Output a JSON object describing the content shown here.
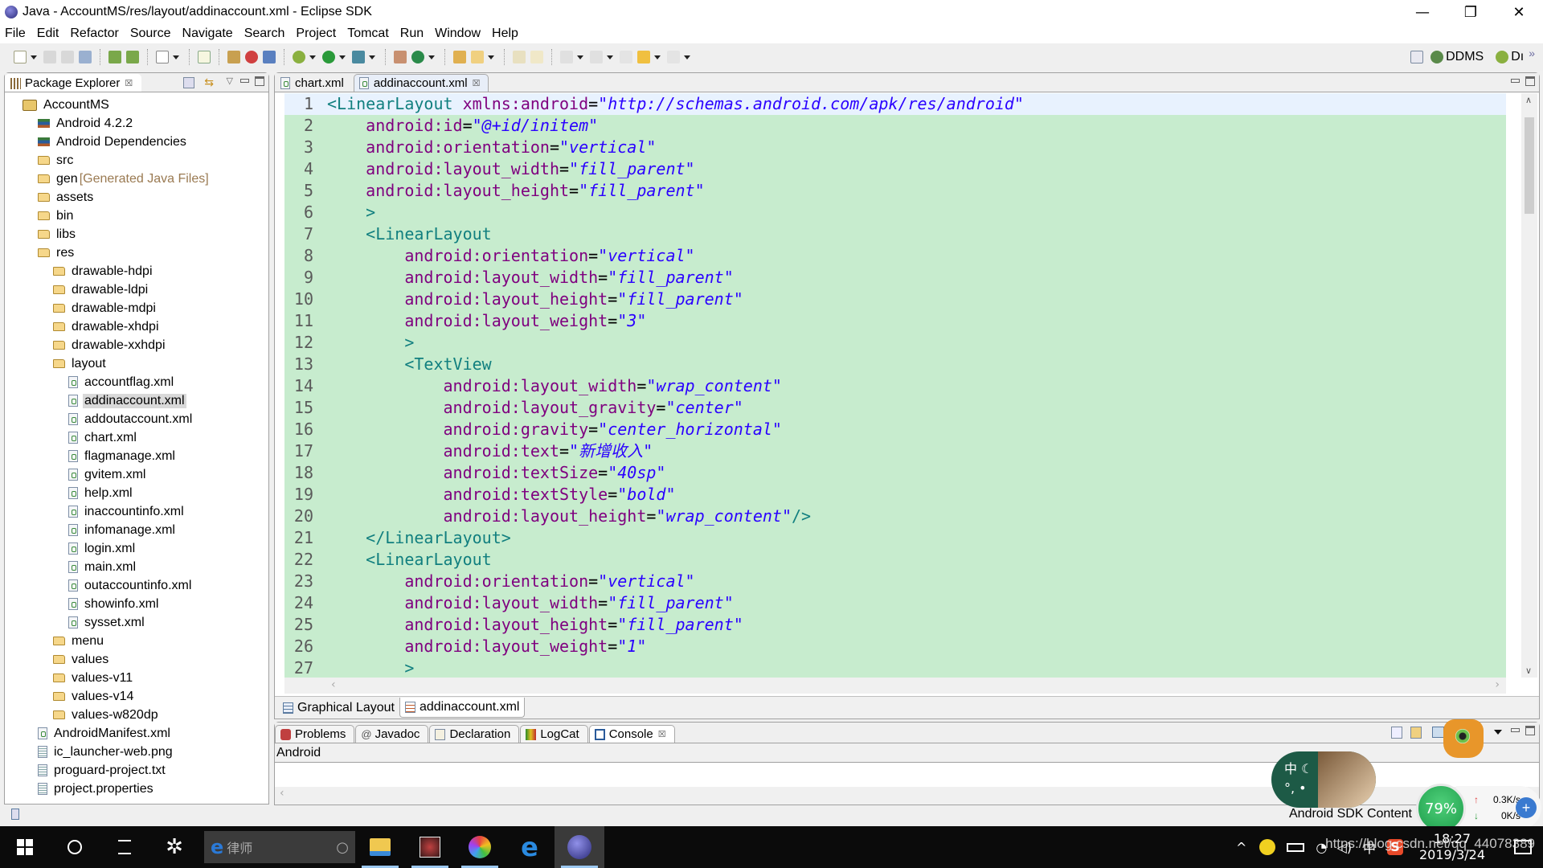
{
  "window": {
    "title": "Java - AccountMS/res/layout/addinaccount.xml - Eclipse SDK",
    "minimize": "—",
    "restore": "❐",
    "close": "✕"
  },
  "menu": [
    "File",
    "Edit",
    "Refactor",
    "Source",
    "Navigate",
    "Search",
    "Project",
    "Tomcat",
    "Run",
    "Window",
    "Help"
  ],
  "perspectives": {
    "ddms": "DDMS",
    "debug": "Dı",
    "more": "»"
  },
  "package_explorer": {
    "title": "Package Explorer",
    "close": "☒",
    "items": [
      {
        "label": "AccountMS",
        "type": "project",
        "depth": 0
      },
      {
        "label": "Android 4.2.2",
        "type": "library",
        "depth": 1
      },
      {
        "label": "Android Dependencies",
        "type": "library",
        "depth": 1
      },
      {
        "label": "src",
        "type": "folder",
        "depth": 1
      },
      {
        "label": "gen",
        "type": "folder",
        "depth": 1,
        "decoration": "[Generated Java Files]"
      },
      {
        "label": "assets",
        "type": "folder",
        "depth": 1
      },
      {
        "label": "bin",
        "type": "folder",
        "depth": 1
      },
      {
        "label": "libs",
        "type": "folder",
        "depth": 1
      },
      {
        "label": "res",
        "type": "folder",
        "depth": 1
      },
      {
        "label": "drawable-hdpi",
        "type": "folder",
        "depth": 2
      },
      {
        "label": "drawable-ldpi",
        "type": "folder",
        "depth": 2
      },
      {
        "label": "drawable-mdpi",
        "type": "folder",
        "depth": 2
      },
      {
        "label": "drawable-xhdpi",
        "type": "folder",
        "depth": 2
      },
      {
        "label": "drawable-xxhdpi",
        "type": "folder",
        "depth": 2
      },
      {
        "label": "layout",
        "type": "folder",
        "depth": 2
      },
      {
        "label": "accountflag.xml",
        "type": "xml",
        "depth": 3
      },
      {
        "label": "addinaccount.xml",
        "type": "xml",
        "depth": 3,
        "selected": true
      },
      {
        "label": "addoutaccount.xml",
        "type": "xml",
        "depth": 3
      },
      {
        "label": "chart.xml",
        "type": "xml",
        "depth": 3
      },
      {
        "label": "flagmanage.xml",
        "type": "xml",
        "depth": 3
      },
      {
        "label": "gvitem.xml",
        "type": "xml",
        "depth": 3
      },
      {
        "label": "help.xml",
        "type": "xml",
        "depth": 3
      },
      {
        "label": "inaccountinfo.xml",
        "type": "xml",
        "depth": 3
      },
      {
        "label": "infomanage.xml",
        "type": "xml",
        "depth": 3
      },
      {
        "label": "login.xml",
        "type": "xml",
        "depth": 3
      },
      {
        "label": "main.xml",
        "type": "xml",
        "depth": 3
      },
      {
        "label": "outaccountinfo.xml",
        "type": "xml",
        "depth": 3
      },
      {
        "label": "showinfo.xml",
        "type": "xml",
        "depth": 3
      },
      {
        "label": "sysset.xml",
        "type": "xml",
        "depth": 3
      },
      {
        "label": "menu",
        "type": "folder",
        "depth": 2
      },
      {
        "label": "values",
        "type": "folder",
        "depth": 2
      },
      {
        "label": "values-v11",
        "type": "folder",
        "depth": 2
      },
      {
        "label": "values-v14",
        "type": "folder",
        "depth": 2
      },
      {
        "label": "values-w820dp",
        "type": "folder",
        "depth": 2
      },
      {
        "label": "AndroidManifest.xml",
        "type": "xml",
        "depth": 1
      },
      {
        "label": "ic_launcher-web.png",
        "type": "file",
        "depth": 1
      },
      {
        "label": "proguard-project.txt",
        "type": "file",
        "depth": 1
      },
      {
        "label": "project.properties",
        "type": "file",
        "depth": 1
      }
    ]
  },
  "editor": {
    "tabs": [
      {
        "label": "chart.xml",
        "active": false
      },
      {
        "label": "addinaccount.xml",
        "active": true,
        "close": "☒"
      }
    ],
    "bottom_tabs": [
      {
        "label": "Graphical Layout",
        "active": false
      },
      {
        "label": "addinaccount.xml",
        "active": true
      }
    ],
    "lines": [
      {
        "n": "1",
        "indent": 0,
        "parts": [
          [
            "tag",
            "<LinearLayout "
          ],
          [
            "attr",
            "xmlns:android"
          ],
          [
            "eq",
            "="
          ],
          [
            "val",
            "\"http://schemas.android.com/apk/res/android\""
          ]
        ]
      },
      {
        "n": "2",
        "indent": 1,
        "parts": [
          [
            "attr",
            "android:id"
          ],
          [
            "eq",
            "="
          ],
          [
            "val",
            "\"@+id/initem\""
          ]
        ]
      },
      {
        "n": "3",
        "indent": 1,
        "parts": [
          [
            "attr",
            "android:orientation"
          ],
          [
            "eq",
            "="
          ],
          [
            "val",
            "\"vertical\""
          ]
        ]
      },
      {
        "n": "4",
        "indent": 1,
        "parts": [
          [
            "attr",
            "android:layout_width"
          ],
          [
            "eq",
            "="
          ],
          [
            "val",
            "\"fill_parent\""
          ]
        ]
      },
      {
        "n": "5",
        "indent": 1,
        "parts": [
          [
            "attr",
            "android:layout_height"
          ],
          [
            "eq",
            "="
          ],
          [
            "val",
            "\"fill_parent\""
          ]
        ]
      },
      {
        "n": "6",
        "indent": 1,
        "parts": [
          [
            "tag",
            ">"
          ]
        ]
      },
      {
        "n": "7",
        "indent": 1,
        "parts": [
          [
            "tag",
            "<LinearLayout"
          ]
        ]
      },
      {
        "n": "8",
        "indent": 2,
        "parts": [
          [
            "attr",
            "android:orientation"
          ],
          [
            "eq",
            "="
          ],
          [
            "val",
            "\"vertical\""
          ]
        ]
      },
      {
        "n": "9",
        "indent": 2,
        "parts": [
          [
            "attr",
            "android:layout_width"
          ],
          [
            "eq",
            "="
          ],
          [
            "val",
            "\"fill_parent\""
          ]
        ]
      },
      {
        "n": "10",
        "indent": 2,
        "parts": [
          [
            "attr",
            "android:layout_height"
          ],
          [
            "eq",
            "="
          ],
          [
            "val",
            "\"fill_parent\""
          ]
        ]
      },
      {
        "n": "11",
        "indent": 2,
        "parts": [
          [
            "attr",
            "android:layout_weight"
          ],
          [
            "eq",
            "="
          ],
          [
            "val",
            "\"3\""
          ]
        ]
      },
      {
        "n": "12",
        "indent": 2,
        "parts": [
          [
            "tag",
            ">"
          ]
        ]
      },
      {
        "n": "13",
        "indent": 2,
        "parts": [
          [
            "tag",
            "<TextView"
          ]
        ]
      },
      {
        "n": "14",
        "indent": 3,
        "parts": [
          [
            "attr",
            "android:layout_width"
          ],
          [
            "eq",
            "="
          ],
          [
            "val",
            "\"wrap_content\""
          ]
        ]
      },
      {
        "n": "15",
        "indent": 3,
        "parts": [
          [
            "attr",
            "android:layout_gravity"
          ],
          [
            "eq",
            "="
          ],
          [
            "val",
            "\"center\""
          ]
        ]
      },
      {
        "n": "16",
        "indent": 3,
        "parts": [
          [
            "attr",
            "android:gravity"
          ],
          [
            "eq",
            "="
          ],
          [
            "val",
            "\"center_horizontal\""
          ]
        ]
      },
      {
        "n": "17",
        "indent": 3,
        "parts": [
          [
            "attr",
            "android:text"
          ],
          [
            "eq",
            "="
          ],
          [
            "val",
            "\"新增收入\""
          ]
        ]
      },
      {
        "n": "18",
        "indent": 3,
        "parts": [
          [
            "attr",
            "android:textSize"
          ],
          [
            "eq",
            "="
          ],
          [
            "val",
            "\"40sp\""
          ]
        ]
      },
      {
        "n": "19",
        "indent": 3,
        "parts": [
          [
            "attr",
            "android:textStyle"
          ],
          [
            "eq",
            "="
          ],
          [
            "val",
            "\"bold\""
          ]
        ]
      },
      {
        "n": "20",
        "indent": 3,
        "parts": [
          [
            "attr",
            "android:layout_height"
          ],
          [
            "eq",
            "="
          ],
          [
            "val",
            "\"wrap_content\""
          ],
          [
            "tag",
            "/>"
          ]
        ]
      },
      {
        "n": "21",
        "indent": 1,
        "parts": [
          [
            "tag",
            "</LinearLayout>"
          ]
        ]
      },
      {
        "n": "22",
        "indent": 1,
        "parts": [
          [
            "tag",
            "<LinearLayout"
          ]
        ]
      },
      {
        "n": "23",
        "indent": 2,
        "parts": [
          [
            "attr",
            "android:orientation"
          ],
          [
            "eq",
            "="
          ],
          [
            "val",
            "\"vertical\""
          ]
        ]
      },
      {
        "n": "24",
        "indent": 2,
        "parts": [
          [
            "attr",
            "android:layout_width"
          ],
          [
            "eq",
            "="
          ],
          [
            "val",
            "\"fill_parent\""
          ]
        ]
      },
      {
        "n": "25",
        "indent": 2,
        "parts": [
          [
            "attr",
            "android:layout_height"
          ],
          [
            "eq",
            "="
          ],
          [
            "val",
            "\"fill_parent\""
          ]
        ]
      },
      {
        "n": "26",
        "indent": 2,
        "parts": [
          [
            "attr",
            "android:layout_weight"
          ],
          [
            "eq",
            "="
          ],
          [
            "val",
            "\"1\""
          ]
        ]
      },
      {
        "n": "27",
        "indent": 2,
        "parts": [
          [
            "tag",
            ">"
          ]
        ]
      }
    ]
  },
  "console": {
    "tabs": [
      {
        "label": "Problems",
        "active": false
      },
      {
        "label": "Javadoc",
        "active": false
      },
      {
        "label": "Declaration",
        "active": false
      },
      {
        "label": "LogCat",
        "active": false
      },
      {
        "label": "Console",
        "active": true,
        "close": "☒"
      }
    ],
    "header": "Android"
  },
  "status": {
    "progress_label": "Android SDK Content"
  },
  "overlay": {
    "ime_labels": [
      "中 ☾",
      "°, •"
    ],
    "memory_percent": "79%",
    "upload_speed": "0.3K/s",
    "download_speed": "0K/s"
  },
  "taskbar": {
    "search_text": "律师",
    "time": "18:27",
    "date": "2019/3/24",
    "tray_ime": "中",
    "watermark": "https://blog.csdn.net/qq_44078389"
  },
  "colors": {
    "editor_bg": "#c7ecce",
    "current_line": "#e8f2fe",
    "tag": "#117f7f",
    "attr": "#7f007f",
    "value": "#2a00ff"
  }
}
